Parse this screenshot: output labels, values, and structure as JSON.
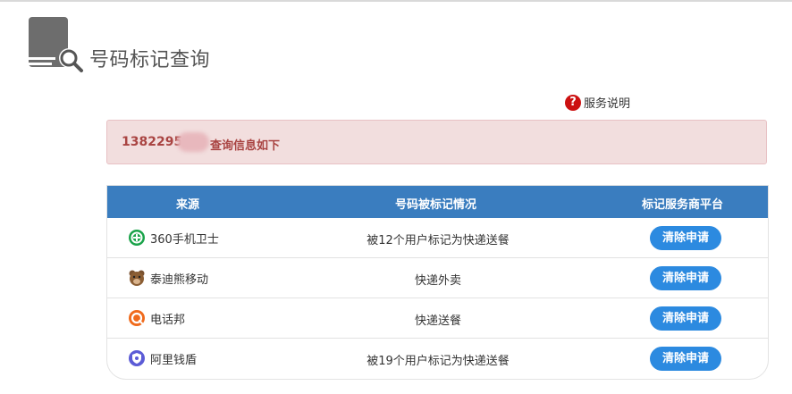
{
  "page": {
    "title": "号码标记查询",
    "help_label": "服务说明",
    "help_icon": "question-circle-icon"
  },
  "alert": {
    "number_visible": "1382295",
    "message": "查询信息如下"
  },
  "table": {
    "columns": [
      "来源",
      "号码被标记情况",
      "标记服务商平台"
    ],
    "rows": [
      {
        "source": "360手机卫士",
        "icon": "360-security-icon",
        "status": "被12个用户标记为快递送餐",
        "action": "清除申请"
      },
      {
        "source": "泰迪熊移动",
        "icon": "teddy-bear-icon",
        "status": "快递外卖",
        "action": "清除申请"
      },
      {
        "source": "电话邦",
        "icon": "dianhuabang-icon",
        "status": "快递送餐",
        "action": "清除申请"
      },
      {
        "source": "阿里钱盾",
        "icon": "ali-qiandun-icon",
        "status": "被19个用户标记为快递送餐",
        "action": "清除申请"
      }
    ]
  },
  "colors": {
    "header_blue": "#3a7dbf",
    "button_blue": "#2c8ae0",
    "alert_bg": "#f2dede",
    "alert_text": "#a94442",
    "help_red": "#cc1111"
  }
}
